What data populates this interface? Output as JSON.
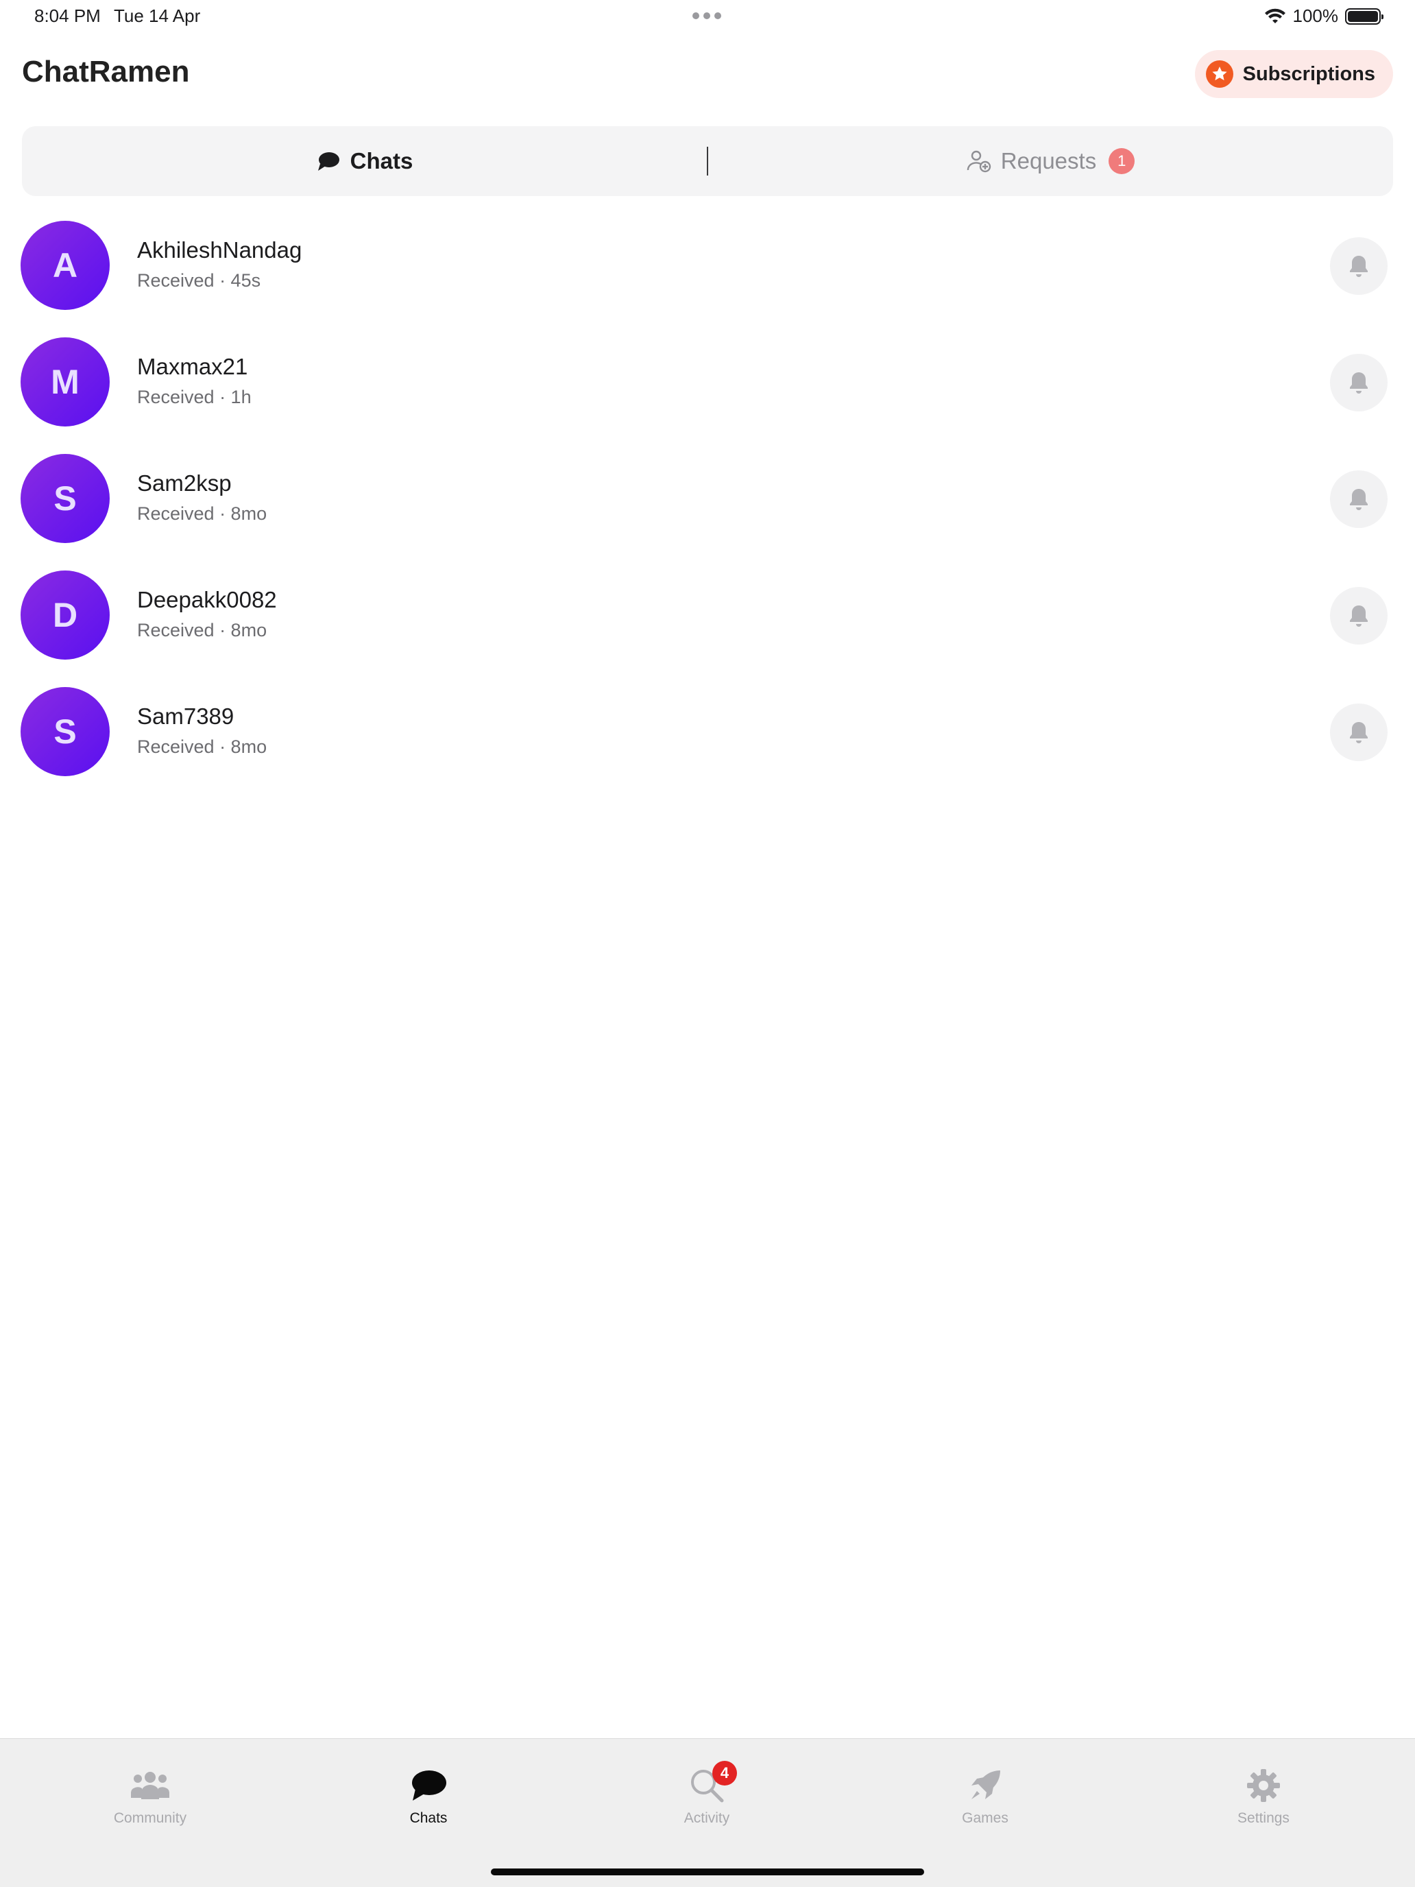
{
  "status": {
    "time": "8:04 PM",
    "date": "Tue 14 Apr",
    "battery": "100%"
  },
  "header": {
    "title": "ChatRamen",
    "subscriptions_label": "Subscriptions"
  },
  "segments": {
    "chats_label": "Chats",
    "requests_label": "Requests",
    "requests_badge": "1"
  },
  "chats": [
    {
      "initial": "A",
      "name": "AkhileshNandag",
      "status": "Received · 45s"
    },
    {
      "initial": "M",
      "name": "Maxmax21",
      "status": "Received · 1h"
    },
    {
      "initial": "S",
      "name": "Sam2ksp",
      "status": "Received · 8mo"
    },
    {
      "initial": "D",
      "name": "Deepakk0082",
      "status": "Received · 8mo"
    },
    {
      "initial": "S",
      "name": "Sam7389",
      "status": "Received · 8mo"
    }
  ],
  "tabbar": {
    "items": [
      {
        "label": "Community",
        "icon": "people-icon"
      },
      {
        "label": "Chats",
        "icon": "chat-bubble-icon",
        "active": true
      },
      {
        "label": "Activity",
        "icon": "search-icon",
        "badge": "4"
      },
      {
        "label": "Games",
        "icon": "rocket-icon"
      },
      {
        "label": "Settings",
        "icon": "gear-icon"
      }
    ]
  },
  "colors": {
    "avatar_gradient_start": "#8a2be2",
    "avatar_gradient_end": "#5a10f0",
    "subscriptions_accent": "#f15a22",
    "badge_red": "#e32424",
    "requests_badge": "#f07b7b"
  }
}
